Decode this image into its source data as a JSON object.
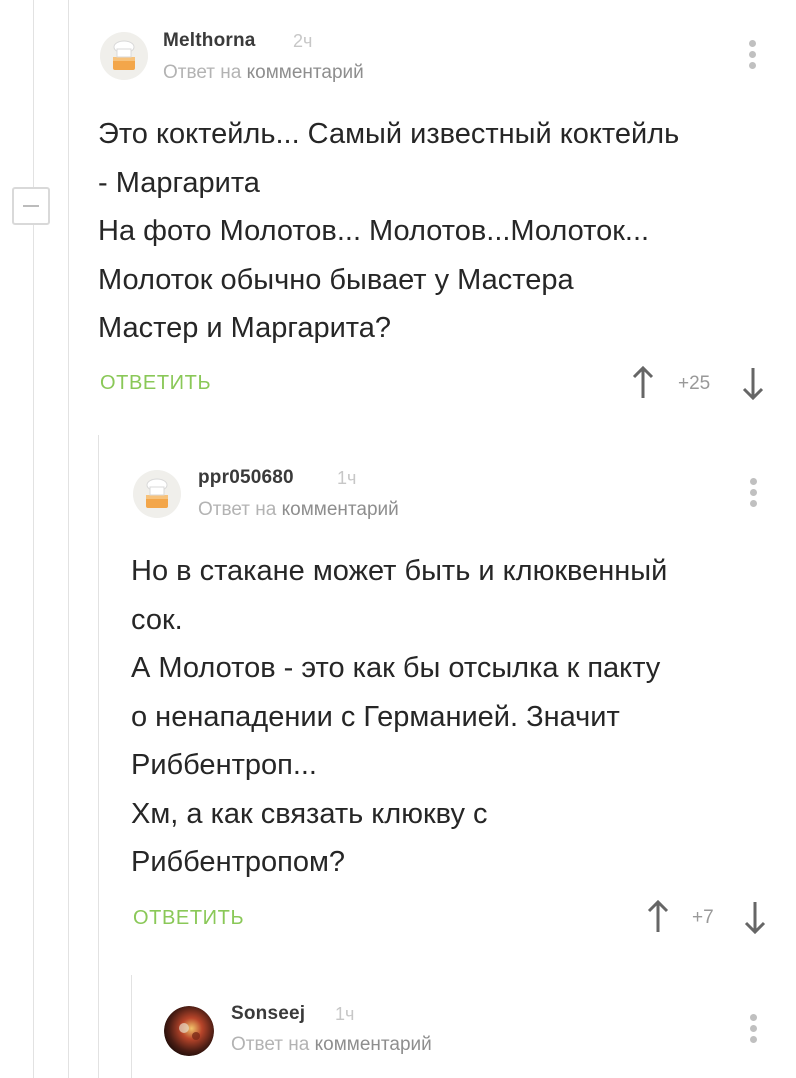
{
  "comments": [
    {
      "username": "Melthorna",
      "time": "2ч",
      "reply_prefix": "Ответ на",
      "reply_target": "комментарий",
      "lines": [
        "Это коктейль... Самый известный коктейль",
        "- Маргарита",
        "На фото Молотов... Молотов...Молоток...",
        "Молоток обычно бывает у Мастера",
        "Мастер и Маргарита?"
      ],
      "reply_label": "ОТВЕТИТЬ",
      "rating": "+25"
    },
    {
      "username": "ppr050680",
      "time": "1ч",
      "reply_prefix": "Ответ на",
      "reply_target": "комментарий",
      "lines": [
        "Но в стакане может быть и клюквенный",
        "сок.",
        "А Молотов - это как бы отсылка к пакту",
        "о ненападении с Германией. Значит",
        "Риббентроп...",
        "Хм, а как связать клюкву с",
        "Риббентропом?"
      ],
      "reply_label": "ОТВЕТИТЬ",
      "rating": "+7"
    },
    {
      "username": "Sonseej",
      "time": "1ч",
      "reply_prefix": "Ответ на",
      "reply_target": "комментарий"
    }
  ],
  "colors": {
    "reply_button": "#8ac858",
    "thread_line": "#e2e2e2",
    "muted_text": "#b3b3b3"
  },
  "icons": {
    "avatar_default": "chef-hat-cake-icon",
    "more": "vertical-dots-icon",
    "upvote": "arrow-up-icon",
    "downvote": "arrow-down-icon",
    "collapse": "minus-box-icon"
  }
}
